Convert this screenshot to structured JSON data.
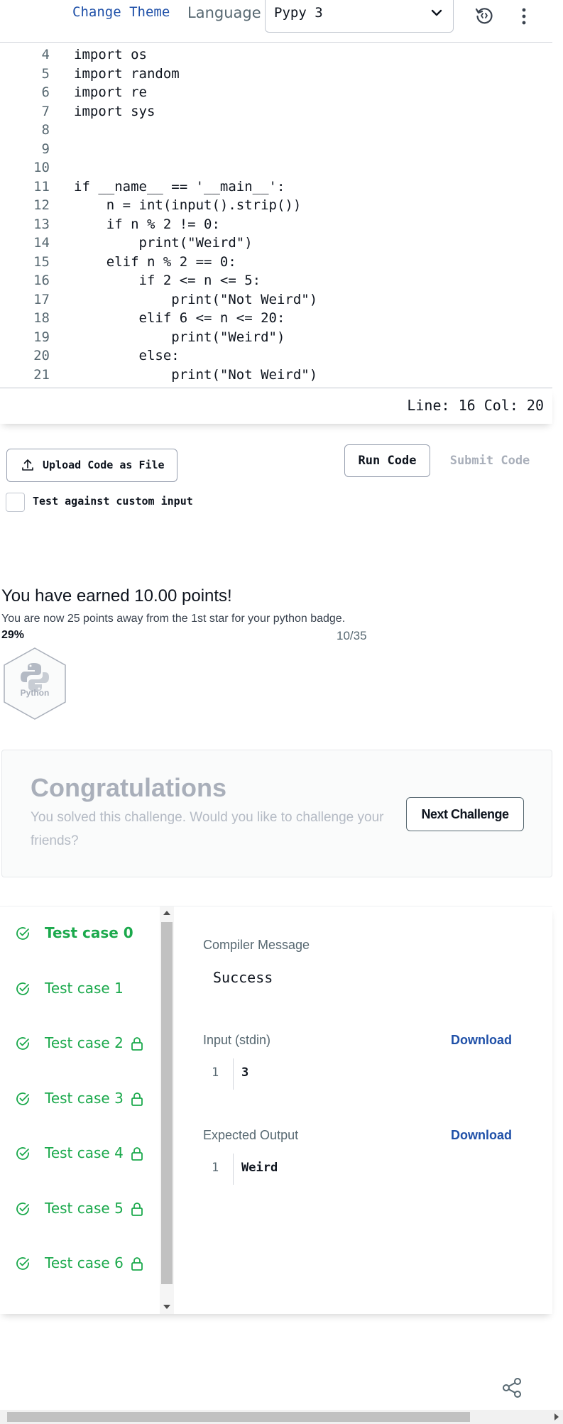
{
  "header": {
    "change_theme": "Change Theme",
    "language_label": "Language",
    "language_value": "Pypy 3"
  },
  "editor": {
    "lines": [
      {
        "n": "4",
        "text": "import os"
      },
      {
        "n": "5",
        "text": "import random"
      },
      {
        "n": "6",
        "text": "import re"
      },
      {
        "n": "7",
        "text": "import sys"
      },
      {
        "n": "8",
        "text": ""
      },
      {
        "n": "9",
        "text": ""
      },
      {
        "n": "10",
        "text": ""
      },
      {
        "n": "11",
        "text": "if __name__ == '__main__':"
      },
      {
        "n": "12",
        "text": "    n = int(input().strip())"
      },
      {
        "n": "13",
        "text": "    if n % 2 != 0:"
      },
      {
        "n": "14",
        "text": "        print(\"Weird\")"
      },
      {
        "n": "15",
        "text": "    elif n % 2 == 0:"
      },
      {
        "n": "16",
        "text": "        if 2 <= n <= 5:"
      },
      {
        "n": "17",
        "text": "            print(\"Not Weird\")"
      },
      {
        "n": "18",
        "text": "        elif 6 <= n <= 20:"
      },
      {
        "n": "19",
        "text": "            print(\"Weird\")"
      },
      {
        "n": "20",
        "text": "        else:"
      },
      {
        "n": "21",
        "text": "            print(\"Not Weird\")"
      }
    ],
    "status": "Line: 16 Col: 20"
  },
  "actions": {
    "upload": "Upload Code as File",
    "run": "Run Code",
    "submit": "Submit Code",
    "custom_input": "Test against custom input"
  },
  "points": {
    "earned": "You have earned 10.00 points!",
    "away": "You are now 25 points away from the 1st star for your python badge.",
    "percent": "29%",
    "fraction": "10/35",
    "badge_label": "Python"
  },
  "congrats": {
    "title": "Congratulations",
    "text": "You solved this challenge. Would you like to challenge your friends?",
    "next": "Next Challenge"
  },
  "tests": {
    "items": [
      {
        "name": "Test case 0",
        "locked": false,
        "active": true
      },
      {
        "name": "Test case 1",
        "locked": false,
        "active": false
      },
      {
        "name": "Test case 2",
        "locked": true,
        "active": false
      },
      {
        "name": "Test case 3",
        "locked": true,
        "active": false
      },
      {
        "name": "Test case 4",
        "locked": true,
        "active": false
      },
      {
        "name": "Test case 5",
        "locked": true,
        "active": false
      },
      {
        "name": "Test case 6",
        "locked": true,
        "active": false
      }
    ],
    "compiler_label": "Compiler Message",
    "compiler_message": "Success",
    "input_label": "Input (stdin)",
    "input_line": "1",
    "input_value": "3",
    "expected_label": "Expected Output",
    "expected_line": "1",
    "expected_value": "Weird",
    "download": "Download"
  },
  "colors": {
    "success": "#1ba94c",
    "link": "#1f50a8",
    "muted": "#a9afba"
  },
  "icons": {
    "upload": "upload-icon",
    "reset": "reset-icon",
    "menu": "kebab-icon",
    "check": "check-circle-icon",
    "lock": "lock-icon",
    "badge": "python-logo-icon",
    "share": "share-icon"
  }
}
